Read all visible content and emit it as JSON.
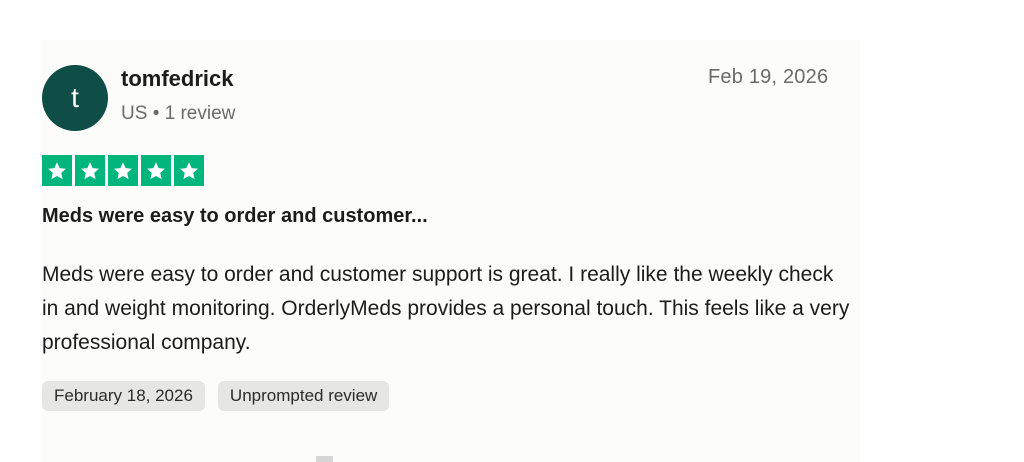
{
  "reviewer": {
    "avatar_initial": "t",
    "name": "tomfedrick",
    "location": "US",
    "review_count": "1 review",
    "meta_separator": "•"
  },
  "review": {
    "date": "Feb 19, 2026",
    "rating": 5,
    "title": "Meds were easy to order and customer...",
    "body": "Meds were easy to order and customer support is great. I really like the weekly check in and weight monitoring. OrderlyMeds provides a personal touch. This feels like a very professional company.",
    "tags": [
      "February 18, 2026",
      "Unprompted review"
    ]
  },
  "colors": {
    "avatar_bg": "#0f4e46",
    "star_green": "#00b67a",
    "tag_bg": "#e6e6e4",
    "text_primary": "#1c1c1c",
    "text_muted": "#6b6b6b"
  },
  "icons": {
    "star": "star-icon"
  }
}
